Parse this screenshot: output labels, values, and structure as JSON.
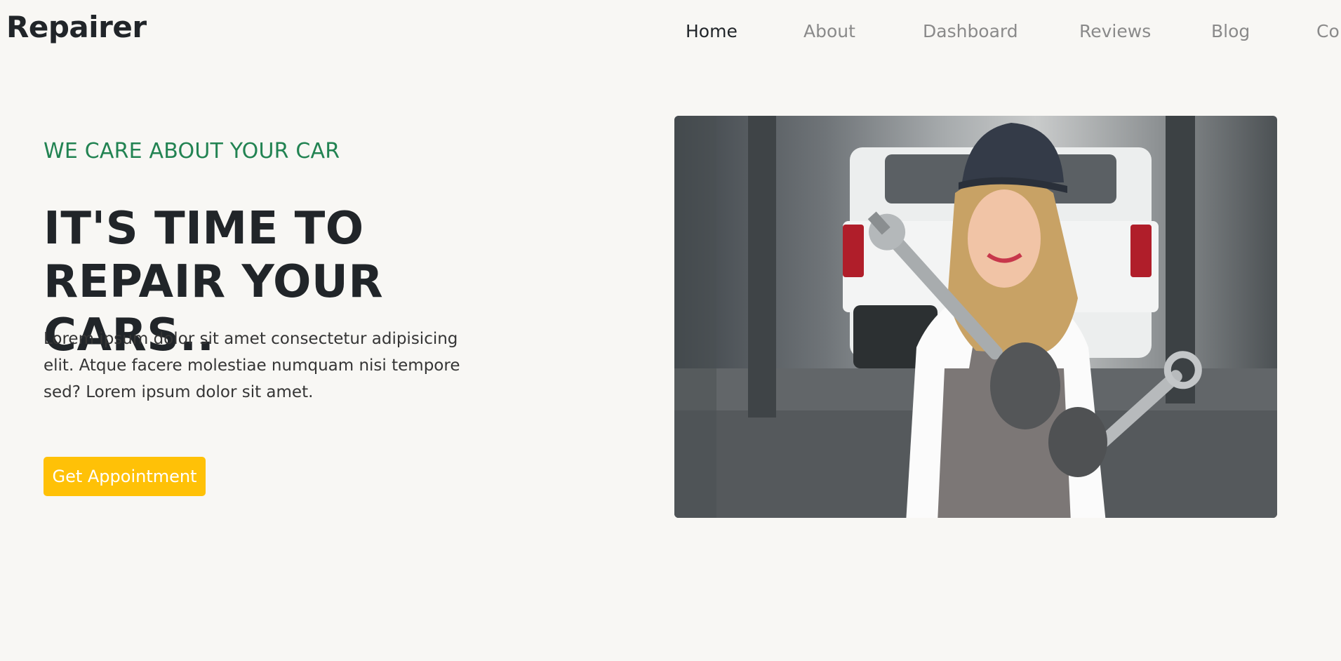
{
  "brand": "Repairer",
  "nav": {
    "items": [
      {
        "label": "Home",
        "active": true
      },
      {
        "label": "About",
        "active": false
      },
      {
        "label": "Dashboard",
        "active": false
      },
      {
        "label": "Reviews",
        "active": false
      },
      {
        "label": "Blog",
        "active": false
      },
      {
        "label": "Co",
        "active": false
      }
    ]
  },
  "hero": {
    "subtitle": "WE CARE ABOUT YOUR CAR",
    "headline_line1": "IT'S TIME TO",
    "headline_line2": "REPAIR YOUR CARS..",
    "description": "Lorem ipsum dolor sit amet consectetur adipisicing elit. Atque facere molestiae numquam nisi tempore sed? Lorem ipsum dolor sit amet.",
    "cta_label": "Get Appointment"
  },
  "colors": {
    "accent_green": "#228352",
    "cta_yellow": "#ffc107",
    "background": "#f8f7f4",
    "text_dark": "#212529",
    "nav_muted": "#8a8a8a"
  }
}
